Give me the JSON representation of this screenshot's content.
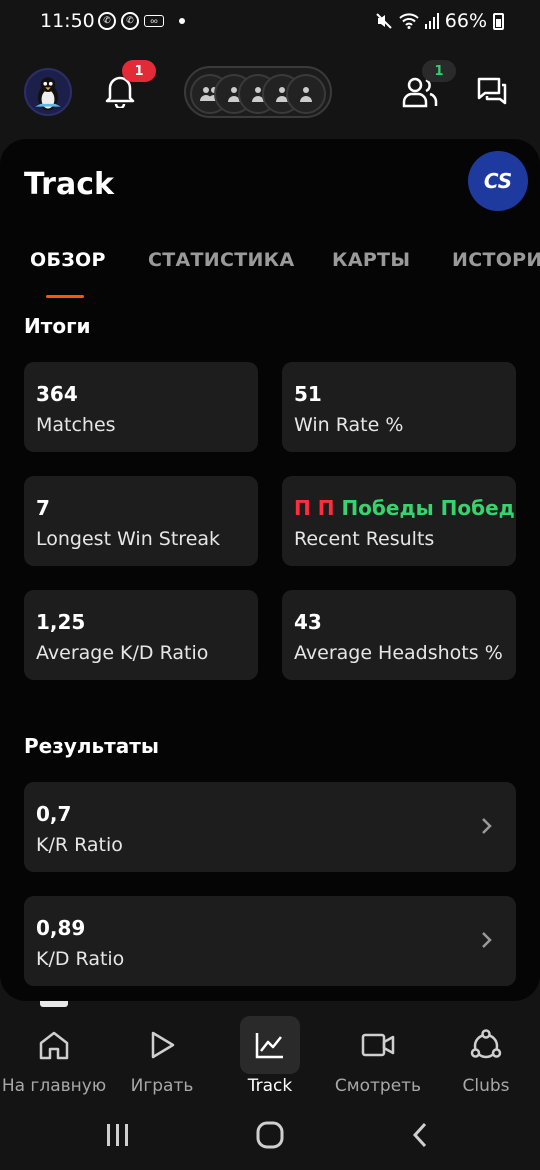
{
  "status_bar": {
    "time": "11:50",
    "battery": "66%",
    "icons": [
      "whatsapp-icon",
      "whatsapp-icon",
      "voicemail-icon",
      "dot-icon",
      "mute-icon",
      "wifi-icon",
      "signal-icon",
      "battery-icon"
    ]
  },
  "top_bar": {
    "notifications_badge": "1",
    "friends_badge": "1",
    "party_slots": 5
  },
  "page": {
    "title": "Track",
    "game_logo_text": "CS"
  },
  "tabs": [
    {
      "label": "ОБЗОР",
      "active": true
    },
    {
      "label": "СТАТИСТИКА",
      "active": false
    },
    {
      "label": "КАРТЫ",
      "active": false
    },
    {
      "label": "ИСТОРИЯ",
      "active": false
    }
  ],
  "summary": {
    "title": "Итоги",
    "matches": {
      "value": "364",
      "label": "Matches"
    },
    "win_rate": {
      "value": "51",
      "label": "Win Rate %"
    },
    "longest_streak": {
      "value": "7",
      "label": "Longest Win Streak"
    },
    "recent_results": {
      "label": "Recent Results",
      "items": [
        {
          "text": "П",
          "type": "loss"
        },
        {
          "text": "П",
          "type": "loss"
        },
        {
          "text": "Победы",
          "type": "win"
        },
        {
          "text": "Победы",
          "type": "win"
        }
      ]
    },
    "avg_kd": {
      "value": "1,25",
      "label": "Average K/D Ratio"
    },
    "avg_hs": {
      "value": "43",
      "label": "Average Headshots %"
    }
  },
  "results": {
    "title": "Результаты",
    "items": [
      {
        "value": "0,7",
        "label": "K/R Ratio"
      },
      {
        "value": "0,89",
        "label": "K/D Ratio"
      }
    ]
  },
  "bottom_nav": [
    {
      "label": "На главную",
      "icon": "home-icon",
      "active": false
    },
    {
      "label": "Играть",
      "icon": "play-icon",
      "active": false
    },
    {
      "label": "Track",
      "icon": "chart-line-icon",
      "active": true
    },
    {
      "label": "Смотреть",
      "icon": "video-icon",
      "active": false
    },
    {
      "label": "Clubs",
      "icon": "clubs-icon",
      "active": false
    }
  ],
  "colors": {
    "accent": "#ff5500",
    "loss": "#ff2d3d",
    "win": "#37d46e",
    "notification_badge": "#e32b38"
  }
}
